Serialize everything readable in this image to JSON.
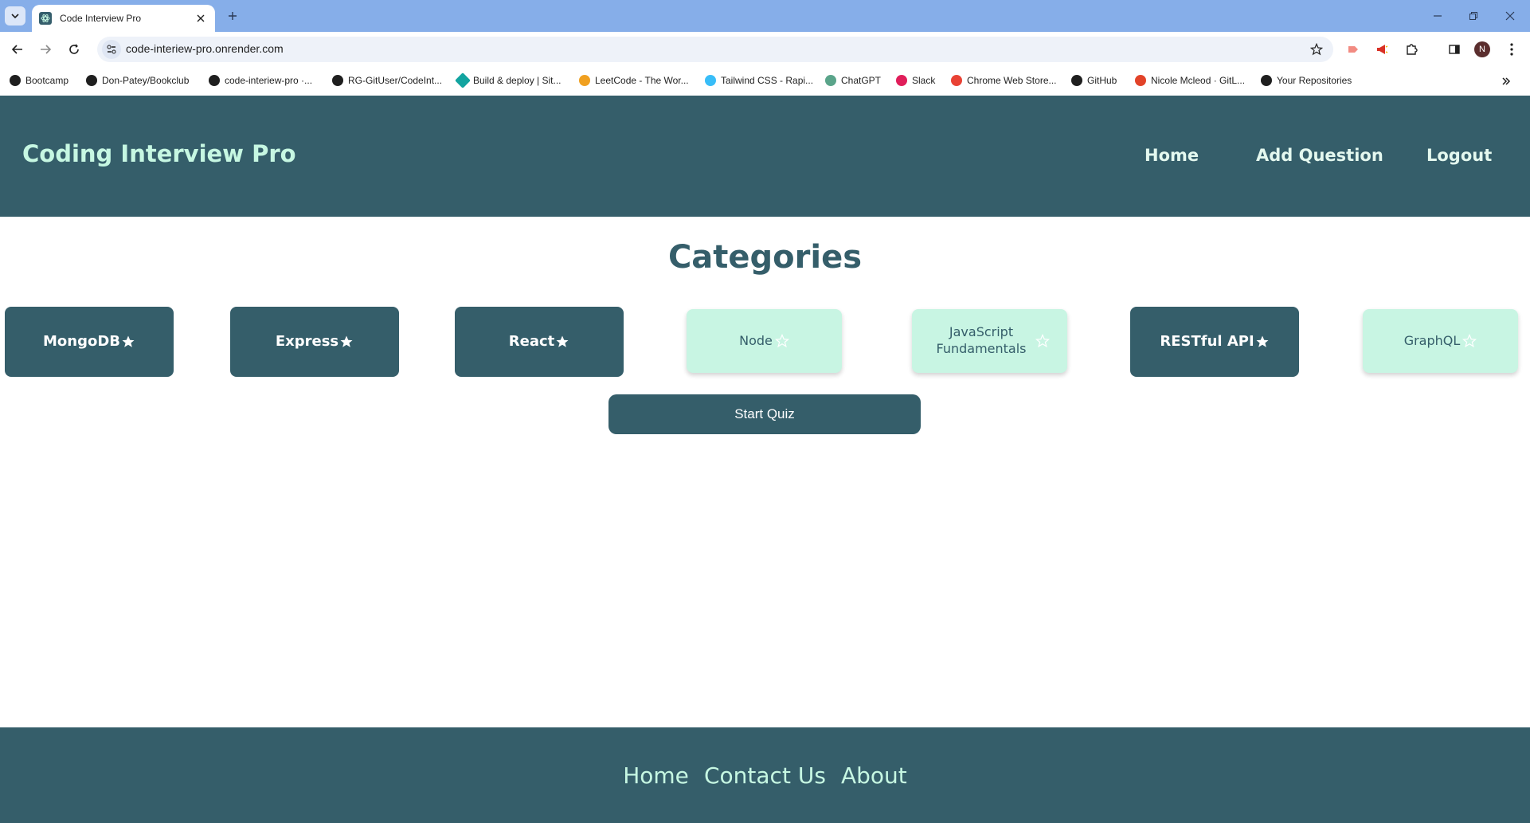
{
  "browser": {
    "tab": {
      "title": "Code Interview Pro"
    },
    "url": "code-interiew-pro.onrender.com",
    "profile_initial": "N",
    "bookmarks": [
      {
        "label": "Bootcamp",
        "color": "#1f1f1f"
      },
      {
        "label": "Don-Patey/Bookclub",
        "color": "#1f1f1f"
      },
      {
        "label": "code-interiew-pro ·...",
        "color": "#1f1f1f"
      },
      {
        "label": "RG-GitUser/CodeInt...",
        "color": "#1f1f1f"
      },
      {
        "label": "Build & deploy | Sit...",
        "color": "#12a4a0"
      },
      {
        "label": "LeetCode - The Wor...",
        "color": "#f0a020"
      },
      {
        "label": "Tailwind CSS - Rapi...",
        "color": "#38bdf8"
      },
      {
        "label": "ChatGPT",
        "color": "#5aa48a"
      },
      {
        "label": "Slack",
        "color": "#e01e5a"
      },
      {
        "label": "Chrome Web Store...",
        "color": "#e94235"
      },
      {
        "label": "GitHub",
        "color": "#1f1f1f"
      },
      {
        "label": "Nicole Mcleod · GitL...",
        "color": "#e24329"
      },
      {
        "label": "Your Repositories",
        "color": "#1f1f1f"
      }
    ]
  },
  "header": {
    "brand": "Coding Interview Pro",
    "nav": {
      "home": "Home",
      "add_question": "Add Question",
      "logout": "Logout"
    }
  },
  "main": {
    "title": "Categories",
    "categories": [
      {
        "label": "MongoDB",
        "favorite": true
      },
      {
        "label": "Express",
        "favorite": true
      },
      {
        "label": "React",
        "favorite": true
      },
      {
        "label": "Node",
        "favorite": false
      },
      {
        "label": "JavaScript Fundamentals",
        "favorite": false
      },
      {
        "label": "RESTful API",
        "favorite": true
      },
      {
        "label": "GraphQL",
        "favorite": false
      }
    ],
    "start_button": "Start Quiz"
  },
  "footer": {
    "links": {
      "home": "Home",
      "contact": "Contact Us",
      "about": "About"
    }
  },
  "colors": {
    "primary": "#355e6a",
    "accent_light": "#c8f5e3",
    "browser_frame": "#86aee9"
  }
}
